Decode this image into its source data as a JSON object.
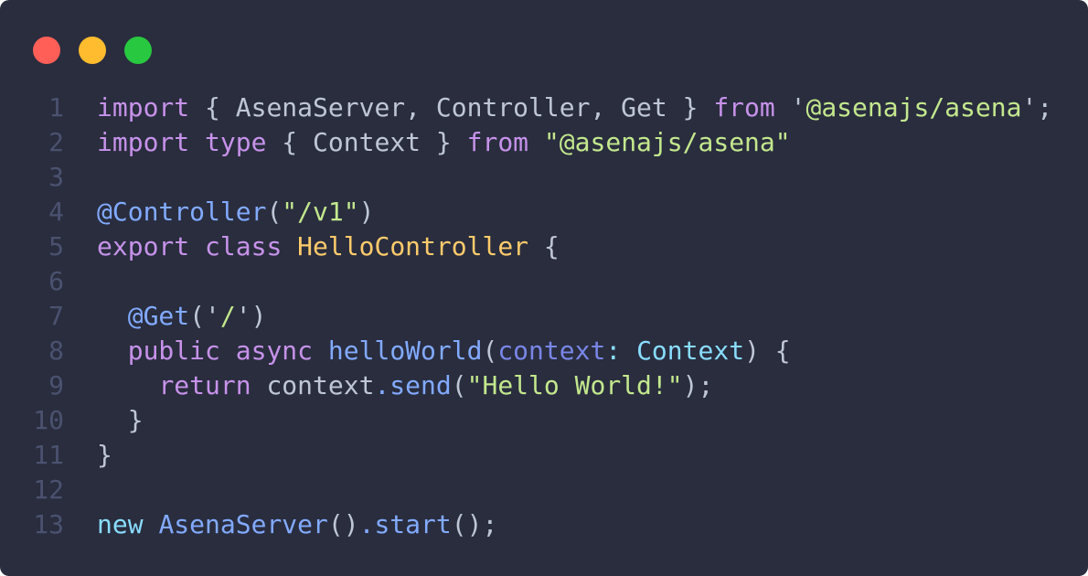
{
  "window": {
    "controls": [
      {
        "name": "close",
        "color": "#ff5f57"
      },
      {
        "name": "minimize",
        "color": "#febc2e"
      },
      {
        "name": "maximize",
        "color": "#28c840"
      }
    ]
  },
  "colors": {
    "background": "#292d3e",
    "line_number": "#4b5270",
    "plain": "#bfc7d5",
    "keyword": "#c792ea",
    "string": "#c3e88d",
    "function": "#82aaff",
    "class": "#ffcb6b",
    "type": "#89ddff",
    "param": "#7986e7"
  },
  "editor": {
    "lines": [
      {
        "number": "1",
        "tokens": [
          {
            "t": "import",
            "c": "keyword"
          },
          {
            "t": " { AsenaServer, Controller, Get } ",
            "c": "plain"
          },
          {
            "t": "from",
            "c": "keyword"
          },
          {
            "t": " '",
            "c": "plain"
          },
          {
            "t": "@asenajs/asena",
            "c": "string"
          },
          {
            "t": "';",
            "c": "plain"
          }
        ]
      },
      {
        "number": "2",
        "tokens": [
          {
            "t": "import",
            "c": "keyword"
          },
          {
            "t": " ",
            "c": "plain"
          },
          {
            "t": "type",
            "c": "keyword"
          },
          {
            "t": " { Context } ",
            "c": "plain"
          },
          {
            "t": "from",
            "c": "keyword"
          },
          {
            "t": " ",
            "c": "plain"
          },
          {
            "t": "\"@asenajs/asena\"",
            "c": "string"
          }
        ]
      },
      {
        "number": "3",
        "tokens": []
      },
      {
        "number": "4",
        "tokens": [
          {
            "t": "@Controller",
            "c": "function"
          },
          {
            "t": "(",
            "c": "plain"
          },
          {
            "t": "\"/v1\"",
            "c": "string"
          },
          {
            "t": ")",
            "c": "plain"
          }
        ]
      },
      {
        "number": "5",
        "tokens": [
          {
            "t": "export",
            "c": "keyword"
          },
          {
            "t": " ",
            "c": "plain"
          },
          {
            "t": "class",
            "c": "keyword"
          },
          {
            "t": " ",
            "c": "plain"
          },
          {
            "t": "HelloController",
            "c": "class"
          },
          {
            "t": " {",
            "c": "plain"
          }
        ]
      },
      {
        "number": "6",
        "tokens": []
      },
      {
        "number": "7",
        "tokens": [
          {
            "t": "  ",
            "c": "plain"
          },
          {
            "t": "@Get",
            "c": "function"
          },
          {
            "t": "('",
            "c": "plain"
          },
          {
            "t": "/",
            "c": "string"
          },
          {
            "t": "')",
            "c": "plain"
          }
        ]
      },
      {
        "number": "8",
        "tokens": [
          {
            "t": "  ",
            "c": "plain"
          },
          {
            "t": "public",
            "c": "keyword"
          },
          {
            "t": " ",
            "c": "plain"
          },
          {
            "t": "async",
            "c": "keyword"
          },
          {
            "t": " ",
            "c": "plain"
          },
          {
            "t": "helloWorld",
            "c": "function"
          },
          {
            "t": "(",
            "c": "plain"
          },
          {
            "t": "context",
            "c": "param"
          },
          {
            "t": ": ",
            "c": "type"
          },
          {
            "t": "Context",
            "c": "type"
          },
          {
            "t": ") {",
            "c": "plain"
          }
        ]
      },
      {
        "number": "9",
        "tokens": [
          {
            "t": "    ",
            "c": "plain"
          },
          {
            "t": "return",
            "c": "keyword"
          },
          {
            "t": " context",
            "c": "plain"
          },
          {
            "t": ".send",
            "c": "function"
          },
          {
            "t": "(",
            "c": "plain"
          },
          {
            "t": "\"Hello World!\"",
            "c": "string"
          },
          {
            "t": ");",
            "c": "plain"
          }
        ]
      },
      {
        "number": "10",
        "tokens": [
          {
            "t": "  }",
            "c": "plain"
          }
        ]
      },
      {
        "number": "11",
        "tokens": [
          {
            "t": "}",
            "c": "plain"
          }
        ]
      },
      {
        "number": "12",
        "tokens": []
      },
      {
        "number": "13",
        "tokens": [
          {
            "t": "new",
            "c": "type"
          },
          {
            "t": " ",
            "c": "plain"
          },
          {
            "t": "AsenaServer",
            "c": "function"
          },
          {
            "t": "()",
            "c": "plain"
          },
          {
            "t": ".start",
            "c": "function"
          },
          {
            "t": "();",
            "c": "plain"
          }
        ]
      }
    ]
  }
}
